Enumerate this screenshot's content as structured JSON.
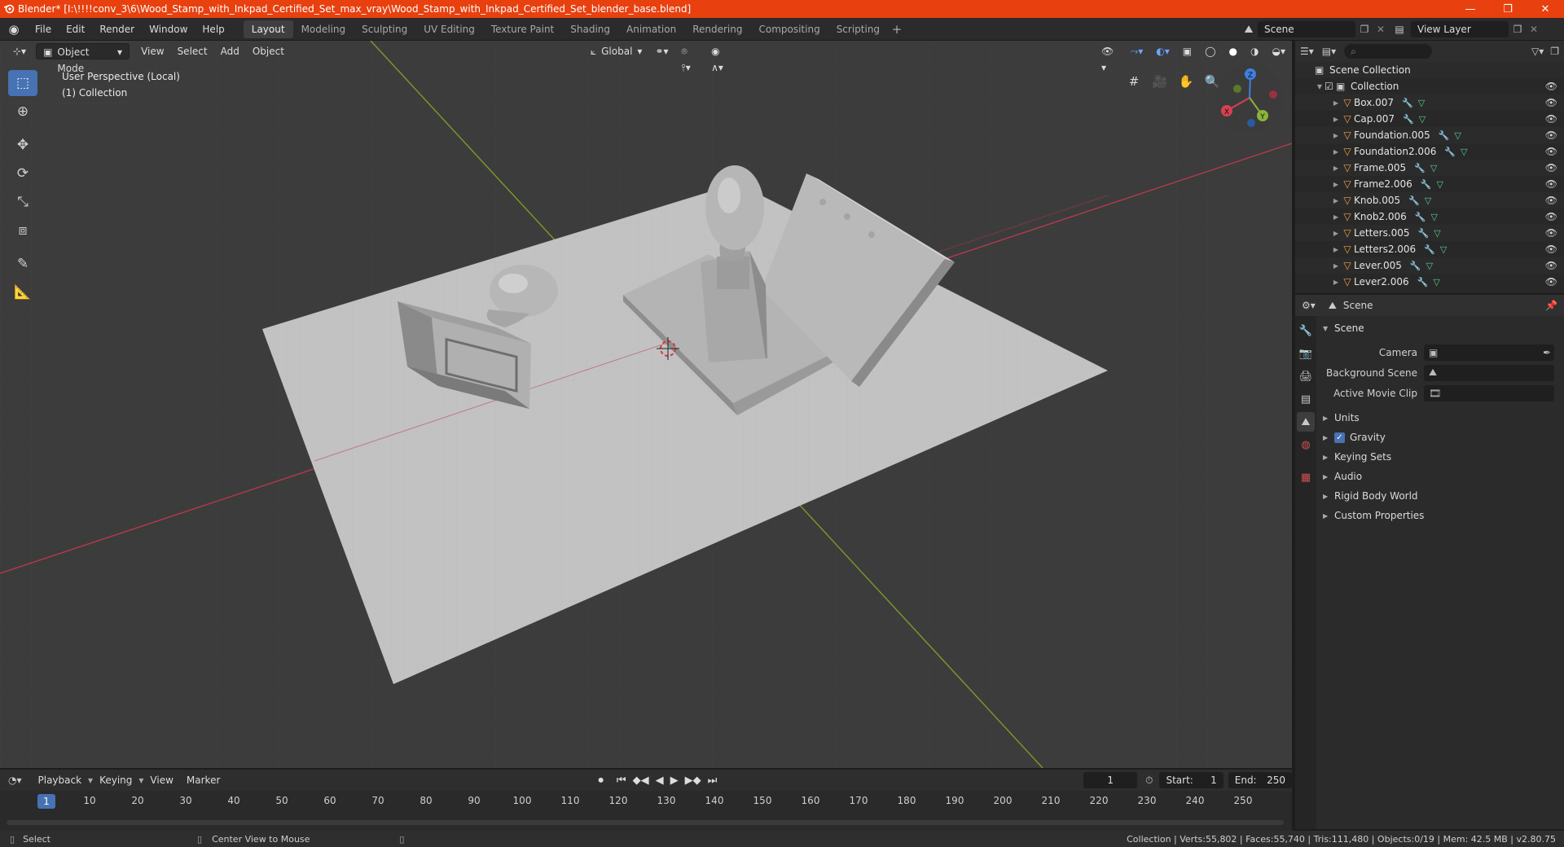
{
  "window": {
    "title": "Blender* [I:\\!!!!conv_3\\6\\Wood_Stamp_with_Inkpad_Certified_Set_max_vray\\Wood_Stamp_with_Inkpad_Certified_Set_blender_base.blend]",
    "minimize": "—",
    "restore": "❐",
    "close": "✕"
  },
  "menu": [
    "File",
    "Edit",
    "Render",
    "Window",
    "Help"
  ],
  "workspaces": [
    "Layout",
    "Modeling",
    "Sculpting",
    "UV Editing",
    "Texture Paint",
    "Shading",
    "Animation",
    "Rendering",
    "Compositing",
    "Scripting"
  ],
  "active_workspace": "Layout",
  "scene_name": "Scene",
  "view_layer": "View Layer",
  "viewport": {
    "mode": "Object Mode",
    "menus": [
      "View",
      "Select",
      "Add",
      "Object"
    ],
    "transform_orientation": "Global",
    "info_line1": "User Perspective (Local)",
    "info_line2": "(1) Collection",
    "gizmo": {
      "x": "X",
      "y": "Y",
      "z": "Z"
    }
  },
  "outliner": {
    "root": "Scene Collection",
    "collection": "Collection",
    "items": [
      "Box.007",
      "Cap.007",
      "Foundation.005",
      "Foundation2.006",
      "Frame.005",
      "Frame2.006",
      "Knob.005",
      "Knob2.006",
      "Letters.005",
      "Letters2.006",
      "Lever.005",
      "Lever2.006"
    ]
  },
  "properties": {
    "context": "Scene",
    "panel": "Scene",
    "camera_label": "Camera",
    "background_scene_label": "Background Scene",
    "active_movie_clip_label": "Active Movie Clip",
    "subpanels": [
      "Units",
      "Gravity",
      "Keying Sets",
      "Audio",
      "Rigid Body World",
      "Custom Properties"
    ]
  },
  "timeline": {
    "menus": [
      "Playback",
      "Keying",
      "View",
      "Marker"
    ],
    "current_frame": "1",
    "start_label": "Start:",
    "start": "1",
    "end_label": "End:",
    "end": "250",
    "ticks": [
      "1",
      "10",
      "20",
      "30",
      "40",
      "50",
      "60",
      "70",
      "80",
      "90",
      "100",
      "110",
      "120",
      "130",
      "140",
      "150",
      "160",
      "170",
      "180",
      "190",
      "200",
      "210",
      "220",
      "230",
      "240",
      "250"
    ]
  },
  "status": {
    "left": "Select",
    "middle": "Center View to Mouse",
    "right": "Collection | Verts:55,802 | Faces:55,740 | Tris:111,480 | Objects:0/19 | Mem: 42.5 MB | v2.80.75"
  },
  "colors": {
    "titlebar": "#e8400f",
    "accent": "#4772b3",
    "object_icon": "#f0a045",
    "axis_x": "#d84050",
    "axis_y": "#8ab33a",
    "axis_z": "#3f7fe0"
  }
}
